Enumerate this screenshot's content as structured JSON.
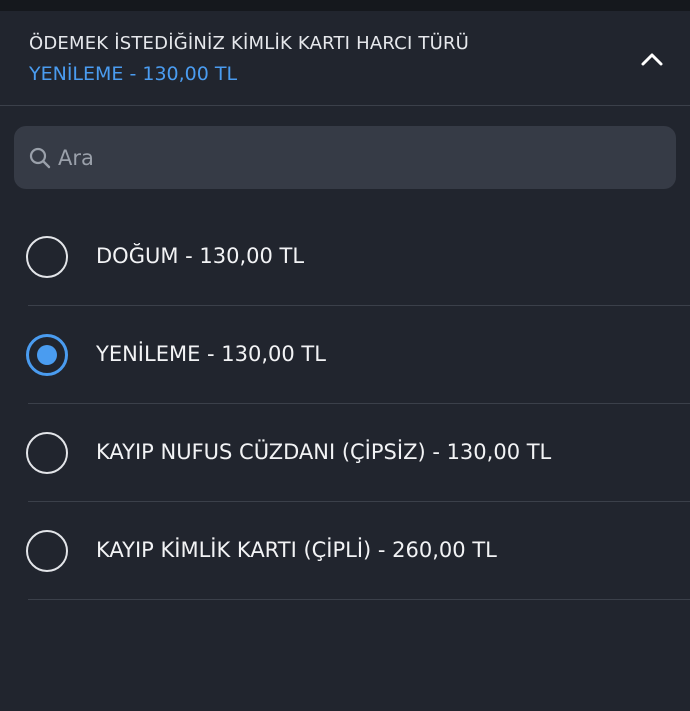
{
  "header": {
    "title": "ÖDEMEK İSTEDİĞİNİZ KİMLİK KARTI HARCI TÜRÜ",
    "selected_value": "YENİLEME - 130,00 TL",
    "collapse_icon": "chevron-up-icon"
  },
  "search": {
    "placeholder": "Ara",
    "value": "",
    "icon": "search-icon"
  },
  "options": [
    {
      "label": "DOĞUM - 130,00 TL",
      "selected": false
    },
    {
      "label": "YENİLEME - 130,00 TL",
      "selected": true
    },
    {
      "label": "KAYIP NUFUS CÜZDANI (ÇİPSİZ) - 130,00 TL",
      "selected": false
    },
    {
      "label": "KAYIP KİMLİK KARTI (ÇİPLİ) - 260,00 TL",
      "selected": false
    }
  ],
  "colors": {
    "background": "#21252e",
    "accent": "#4a9cf0",
    "search_background": "#363b46",
    "divider": "#3b404a"
  }
}
